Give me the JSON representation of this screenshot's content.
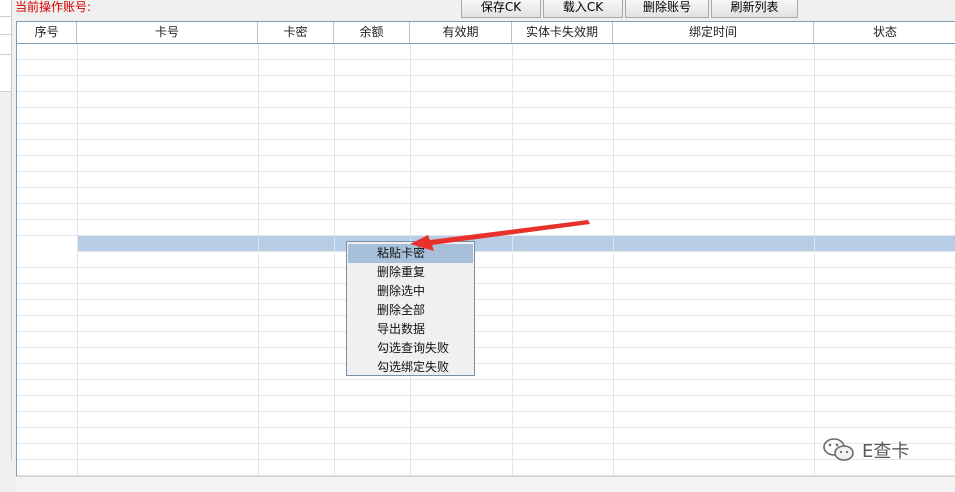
{
  "header": {
    "account_label": "当前操作账号:"
  },
  "toolbar": {
    "buttons": [
      {
        "label": "保存CK"
      },
      {
        "label": "载入CK"
      },
      {
        "label": "删除账号"
      },
      {
        "label": "刷新列表"
      }
    ]
  },
  "table": {
    "columns": [
      "序号",
      "卡号",
      "卡密",
      "余额",
      "有效期",
      "实体卡失效期",
      "绑定时间",
      "状态"
    ]
  },
  "context_menu": {
    "items": [
      "粘贴卡密",
      "删除重复",
      "删除选中",
      "删除全部",
      "导出数据",
      "勾选查询失败",
      "勾选绑定失败"
    ]
  },
  "annotation": {
    "arrow_color": "#e8312b"
  },
  "watermark": {
    "text": "E查卡",
    "icon": "wechat-icon"
  },
  "colors": {
    "label_red": "#d40000",
    "selection": "#b7cde6",
    "menu_hover": "#a8bfd9"
  }
}
